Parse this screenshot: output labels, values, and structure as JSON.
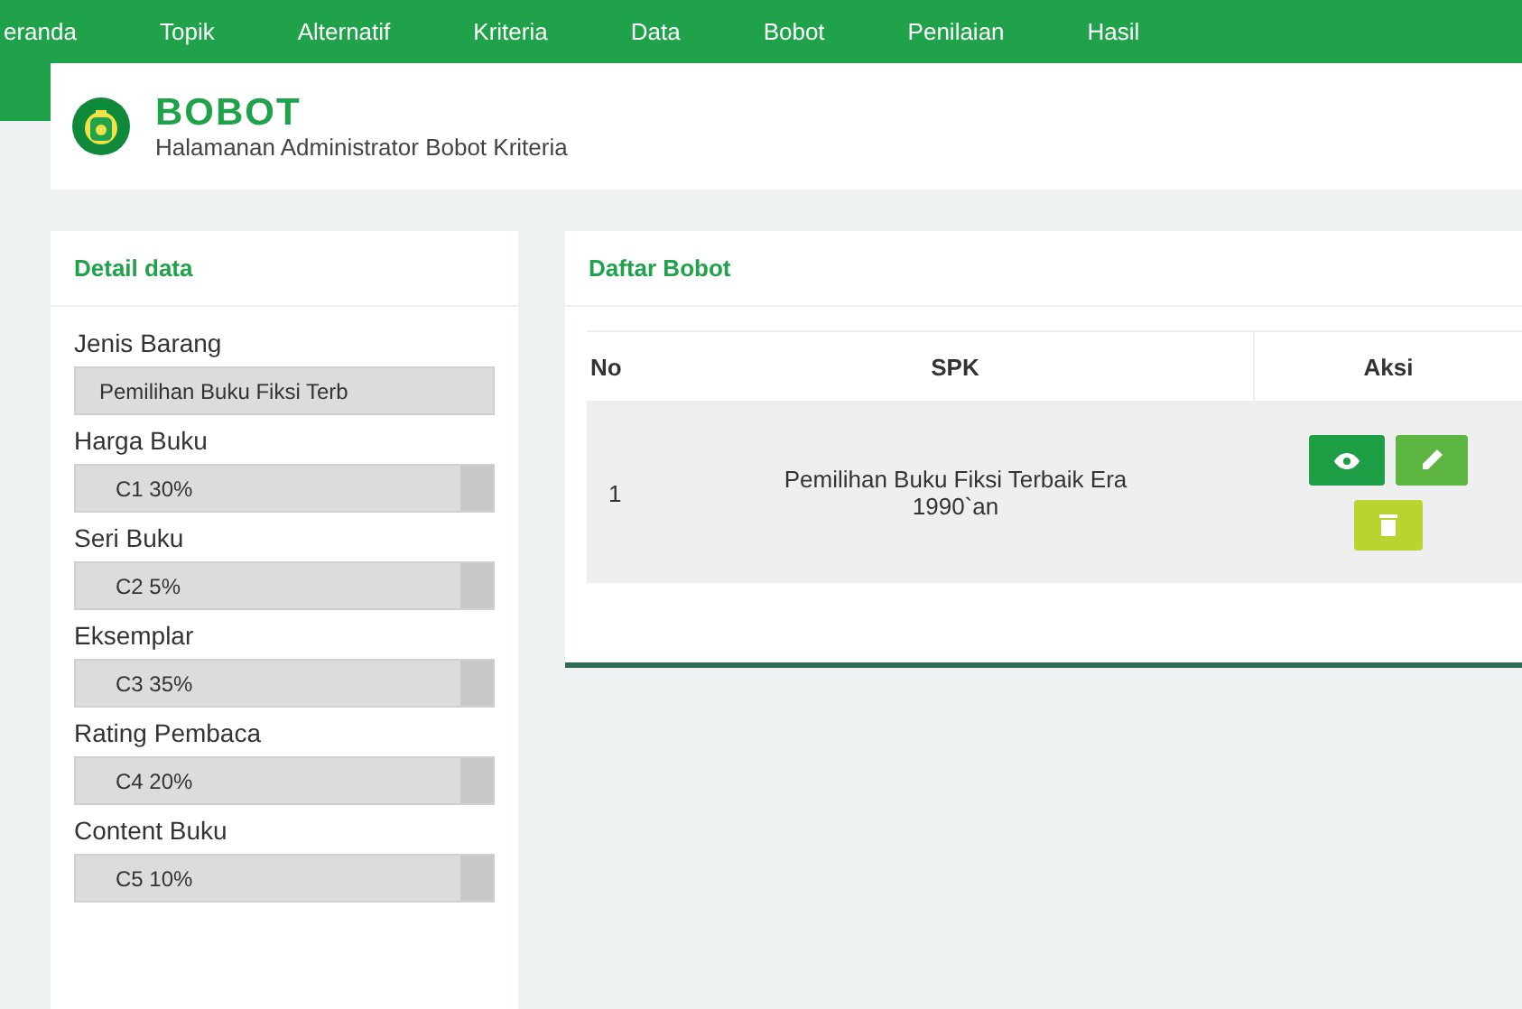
{
  "nav": {
    "items": [
      {
        "label": "eranda",
        "selected": false
      },
      {
        "label": "Topik",
        "selected": false
      },
      {
        "label": "Alternatif",
        "selected": false
      },
      {
        "label": "Kriteria",
        "selected": false
      },
      {
        "label": "Data",
        "selected": false
      },
      {
        "label": "Bobot",
        "selected": false
      },
      {
        "label": "Penilaian",
        "selected": false
      },
      {
        "label": "Hasil",
        "selected": false
      }
    ]
  },
  "header": {
    "title": "BOBOT",
    "subtitle": "Halamanan Administrator Bobot Kriteria"
  },
  "detail_panel": {
    "title": "Detail data",
    "fields": [
      {
        "label": "Jenis Barang",
        "kind": "text",
        "value": "Pemilihan Buku Fiksi Terb"
      },
      {
        "label": "Harga Buku",
        "kind": "select",
        "value": "C1 30%"
      },
      {
        "label": "Seri Buku",
        "kind": "select",
        "value": "C2 5%"
      },
      {
        "label": "Eksemplar",
        "kind": "select",
        "value": "C3 35%"
      },
      {
        "label": "Rating Pembaca",
        "kind": "select",
        "value": "C4 20%"
      },
      {
        "label": "Content Buku",
        "kind": "select",
        "value": "C5 10%"
      }
    ]
  },
  "list_panel": {
    "title": "Daftar Bobot",
    "table": {
      "columns": [
        "No",
        "SPK",
        "Aksi"
      ],
      "rows": [
        {
          "no": "1",
          "spk": "Pemilihan Buku Fiksi Terbaik Era 1990`an",
          "actions": [
            {
              "kind": "view"
            },
            {
              "kind": "edit"
            },
            {
              "kind": "delete"
            }
          ]
        }
      ]
    }
  }
}
